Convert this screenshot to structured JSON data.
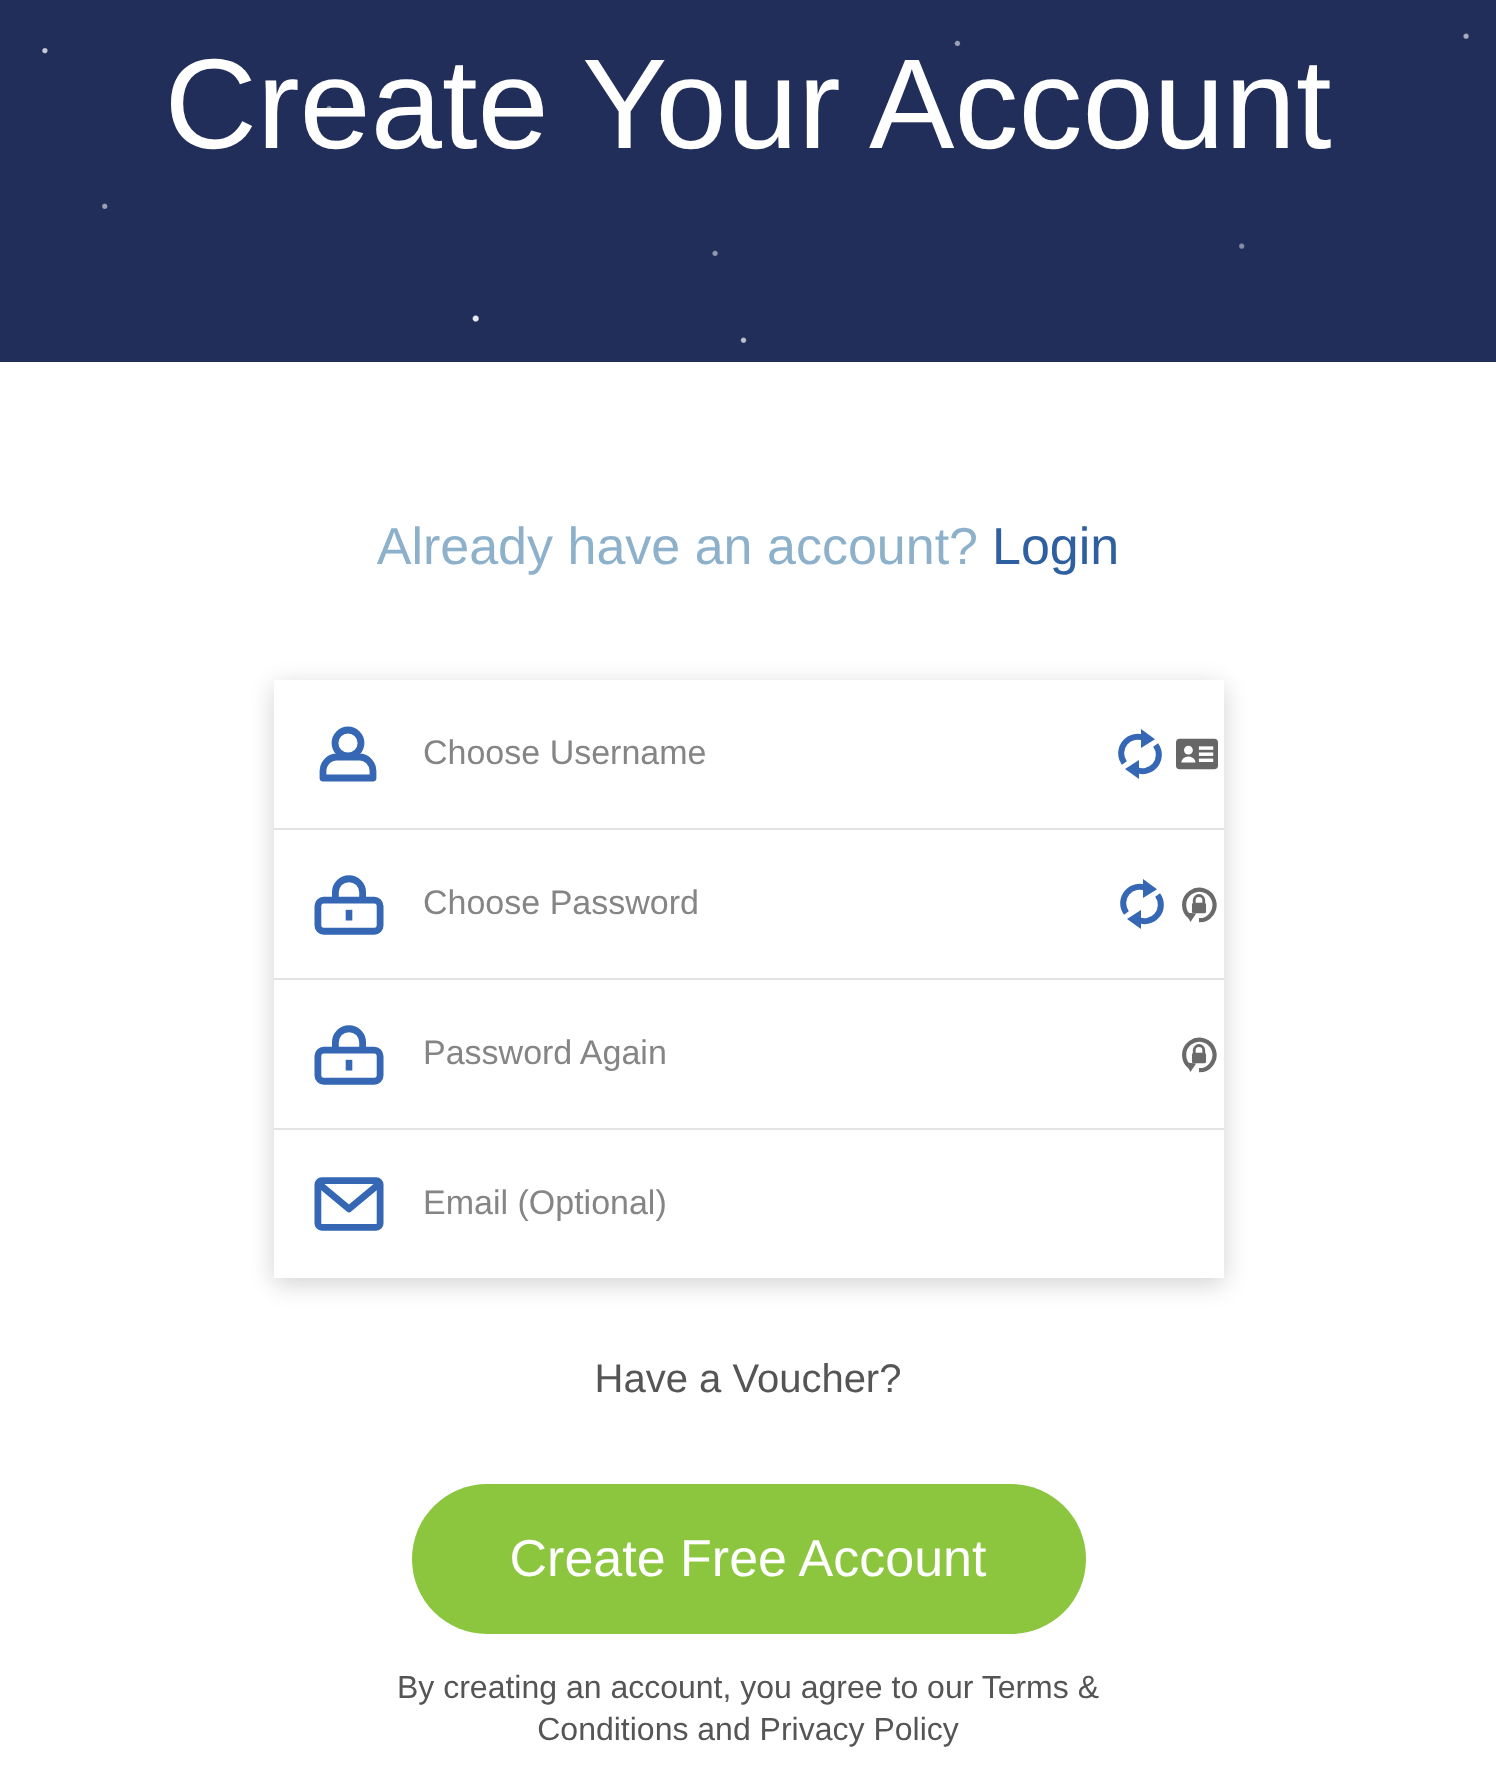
{
  "header": {
    "title": "Create Your Account"
  },
  "login_prompt": {
    "text": "Already have an account?",
    "link": "Login"
  },
  "form": {
    "fields": [
      {
        "kind": "username",
        "placeholder": "Choose Username",
        "generator": true,
        "autofill": true
      },
      {
        "kind": "password",
        "placeholder": "Choose Password",
        "generator": true,
        "autofill": true
      },
      {
        "kind": "password",
        "placeholder": "Password Again",
        "generator": false,
        "autofill": true
      },
      {
        "kind": "email",
        "placeholder": "Email (Optional)",
        "generator": false,
        "autofill": false
      }
    ]
  },
  "voucher_link": "Have a Voucher?",
  "submit_button": "Create Free Account",
  "terms": "By creating an account, you agree to our Terms & Conditions and Privacy Policy"
}
